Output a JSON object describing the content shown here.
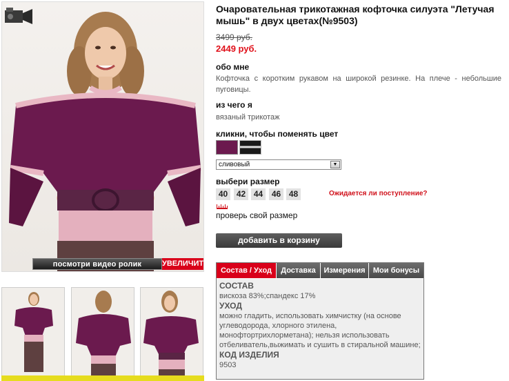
{
  "product": {
    "title": "Очаровательная трикотажная кофточка силуэта \"Летучая мышь\" в двух цветах(№9503)",
    "old_price": "3499 руб.",
    "new_price": "2449 руб."
  },
  "about": {
    "heading": "обо мне",
    "text": "Кофточка с коротким рукавом на широкой резинке. На плече - небольшие пуговицы."
  },
  "material": {
    "heading": "из чего я",
    "text": "вязаный трикотаж"
  },
  "color": {
    "heading": "кликни, чтобы поменять цвет",
    "swatches": [
      "#6b1a4e",
      "#1a1a1a"
    ],
    "selected": "сливовый",
    "arrow": "▼"
  },
  "size": {
    "heading": "выбери размер",
    "options": [
      "40",
      "42",
      "44",
      "46",
      "48"
    ],
    "notify_link": "Ожидается ли поступление?",
    "check_size": "проверь свой размер"
  },
  "cart": {
    "button": "добавить в корзину"
  },
  "photo": {
    "video_link": "посмотри видео ролик",
    "zoom_link": "УВЕЛИЧИТЬ"
  },
  "tabs": {
    "items": [
      "Состав / Уход",
      "Доставка",
      "Измерения",
      "Мои бонусы"
    ],
    "active": "Состав / Уход",
    "content": {
      "composition_heading": "СОСТАВ",
      "composition_text": "вискоза 83%;спандекс 17%",
      "care_heading": "УХОД",
      "care_text": "можно гладить, использовать химчистку (на основе углеводорода, хлорного этилена, монофтортрихлорметана); нельзя использовать отбеливатель,выжимать и сушить в стиральной машине;",
      "code_heading": "КОД ИЗДЕЛИЯ",
      "code_text": "9503"
    }
  },
  "colors": {
    "accent_red": "#d9001a",
    "plum": "#6b1a4e",
    "pink_trim": "#e9b8c4"
  }
}
